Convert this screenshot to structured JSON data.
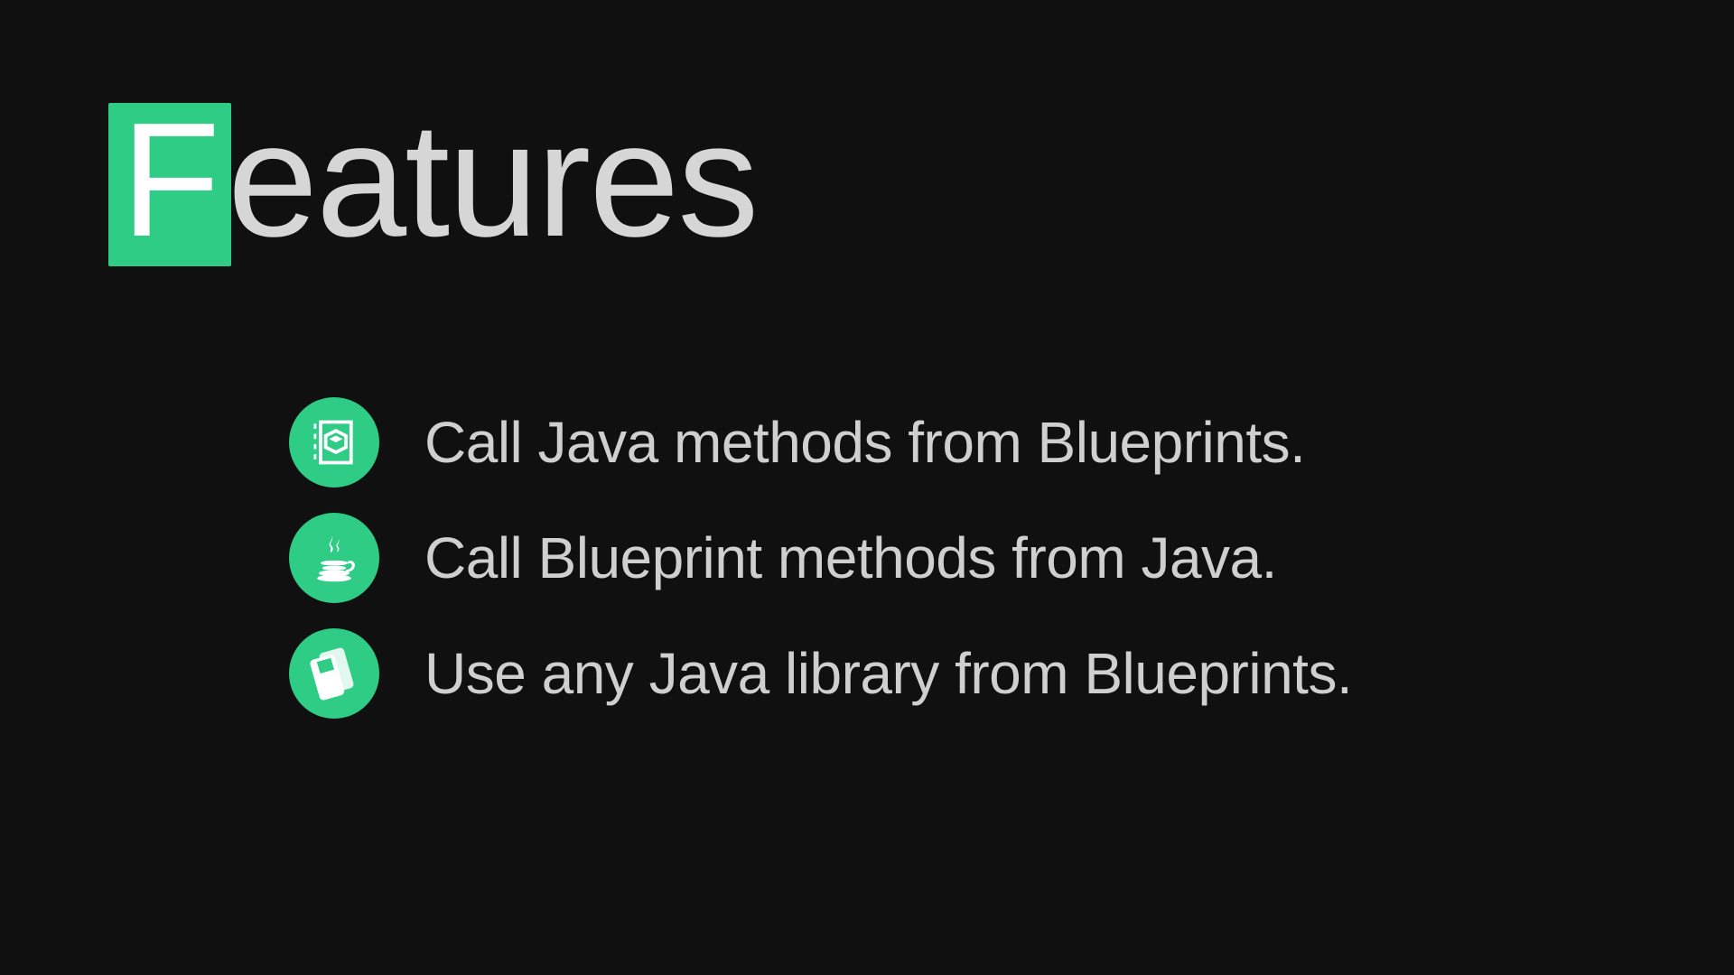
{
  "accent_color": "#2ecc85",
  "title": {
    "dropcap": "F",
    "rest": "eatures"
  },
  "features": [
    {
      "icon": "blueprint-cube-icon",
      "text": "Call Java methods from Blueprints."
    },
    {
      "icon": "java-icon",
      "text": "Call Blueprint methods from Java."
    },
    {
      "icon": "library-books-icon",
      "text": "Use any Java library from Blueprints."
    }
  ]
}
